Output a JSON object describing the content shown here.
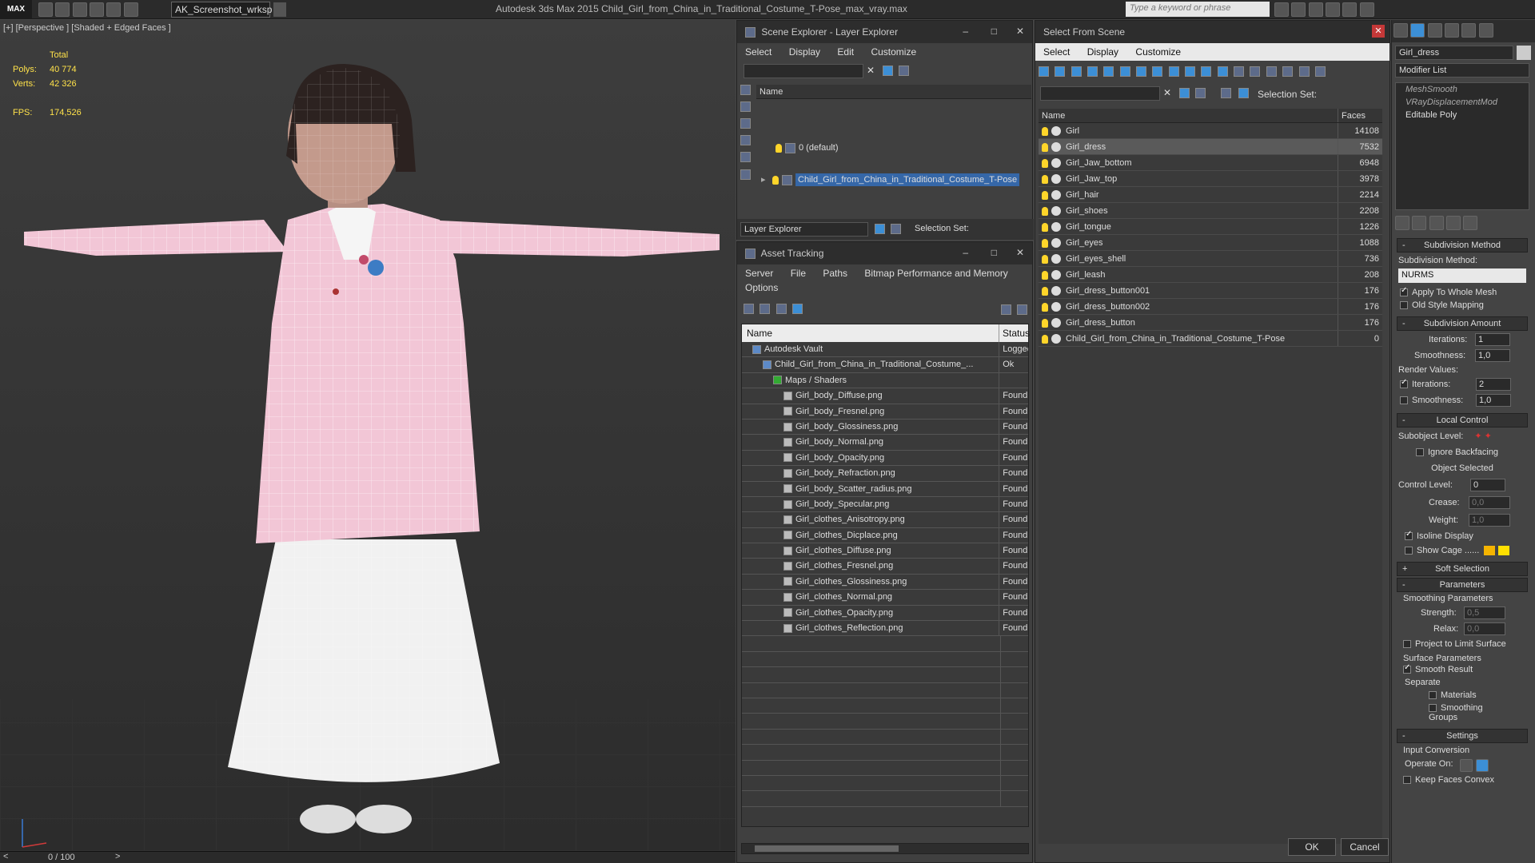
{
  "app": {
    "logo": "MAX",
    "workspace": "AK_Screenshot_wrksp",
    "title": "Autodesk 3ds Max  2015    Child_Girl_from_China_in_Traditional_Costume_T-Pose_max_vray.max",
    "search_placeholder": "Type a keyword or phrase"
  },
  "viewport": {
    "label": "[+] [Perspective ] [Shaded + Edged Faces ]",
    "stats": {
      "total_label": "Total",
      "polys_label": "Polys:",
      "polys": "40 774",
      "verts_label": "Verts:",
      "verts": "42 326",
      "fps_label": "FPS:",
      "fps": "174,526"
    },
    "timeline": "0 / 100",
    "model_colors": {
      "top": "#f2c6d6",
      "skirt": "#f1f1f1"
    }
  },
  "layer_explorer": {
    "title": "Scene Explorer - Layer Explorer",
    "menu": [
      "Select",
      "Display",
      "Edit",
      "Customize"
    ],
    "col_name": "Name",
    "layers": [
      "0 (default)",
      "Child_Girl_from_China_in_Traditional_Costume_T-Pose"
    ],
    "footer_label": "Layer Explorer",
    "selection_set": "Selection Set:"
  },
  "asset_tracking": {
    "title": "Asset Tracking",
    "menu": [
      "Server",
      "File",
      "Paths",
      "Bitmap Performance and Memory"
    ],
    "menu2": "Options",
    "col_name": "Name",
    "col_status": "Status",
    "rows": [
      {
        "name": "Autodesk Vault",
        "status": "Logged",
        "indent": 1
      },
      {
        "name": "Child_Girl_from_China_in_Traditional_Costume_...",
        "status": "Ok",
        "indent": 2
      },
      {
        "name": "Maps / Shaders",
        "status": "",
        "indent": 3
      },
      {
        "name": "Girl_body_Diffuse.png",
        "status": "Found",
        "indent": 4
      },
      {
        "name": "Girl_body_Fresnel.png",
        "status": "Found",
        "indent": 4
      },
      {
        "name": "Girl_body_Glossiness.png",
        "status": "Found",
        "indent": 4
      },
      {
        "name": "Girl_body_Normal.png",
        "status": "Found",
        "indent": 4
      },
      {
        "name": "Girl_body_Opacity.png",
        "status": "Found",
        "indent": 4
      },
      {
        "name": "Girl_body_Refraction.png",
        "status": "Found",
        "indent": 4
      },
      {
        "name": "Girl_body_Scatter_radius.png",
        "status": "Found",
        "indent": 4
      },
      {
        "name": "Girl_body_Specular.png",
        "status": "Found",
        "indent": 4
      },
      {
        "name": "Girl_clothes_Anisotropy.png",
        "status": "Found",
        "indent": 4
      },
      {
        "name": "Girl_clothes_Dicplace.png",
        "status": "Found",
        "indent": 4
      },
      {
        "name": "Girl_clothes_Diffuse.png",
        "status": "Found",
        "indent": 4
      },
      {
        "name": "Girl_clothes_Fresnel.png",
        "status": "Found",
        "indent": 4
      },
      {
        "name": "Girl_clothes_Glossiness.png",
        "status": "Found",
        "indent": 4
      },
      {
        "name": "Girl_clothes_Normal.png",
        "status": "Found",
        "indent": 4
      },
      {
        "name": "Girl_clothes_Opacity.png",
        "status": "Found",
        "indent": 4
      },
      {
        "name": "Girl_clothes_Reflection.png",
        "status": "Found",
        "indent": 4
      }
    ]
  },
  "select_from_scene": {
    "title": "Select From Scene",
    "menu": [
      "Select",
      "Display",
      "Customize"
    ],
    "selection_set": "Selection Set:",
    "col_name": "Name",
    "col_faces": "Faces",
    "rows": [
      {
        "name": "Girl",
        "faces": "14108"
      },
      {
        "name": "Girl_dress",
        "faces": "7532",
        "selected": true
      },
      {
        "name": "Girl_Jaw_bottom",
        "faces": "6948"
      },
      {
        "name": "Girl_Jaw_top",
        "faces": "3978"
      },
      {
        "name": "Girl_hair",
        "faces": "2214"
      },
      {
        "name": "Girl_shoes",
        "faces": "2208"
      },
      {
        "name": "Girl_tongue",
        "faces": "1226"
      },
      {
        "name": "Girl_eyes",
        "faces": "1088"
      },
      {
        "name": "Girl_eyes_shell",
        "faces": "736"
      },
      {
        "name": "Girl_leash",
        "faces": "208"
      },
      {
        "name": "Girl_dress_button001",
        "faces": "176"
      },
      {
        "name": "Girl_dress_button002",
        "faces": "176"
      },
      {
        "name": "Girl_dress_button",
        "faces": "176"
      },
      {
        "name": "Child_Girl_from_China_in_Traditional_Costume_T-Pose",
        "faces": "0"
      }
    ],
    "ok": "OK",
    "cancel": "Cancel"
  },
  "modify": {
    "object_name": "Girl_dress",
    "modifier_list": "Modifier List",
    "stack": [
      "MeshSmooth",
      "VRayDisplacementMod",
      "Editable Poly"
    ],
    "subdivision_method": {
      "header": "Subdivision Method",
      "label": "Subdivision Method:",
      "value": "NURMS",
      "apply": "Apply To Whole Mesh",
      "old": "Old Style Mapping"
    },
    "subdivision_amount": {
      "header": "Subdivision Amount",
      "iter_label": "Iterations:",
      "iter": "1",
      "smooth_label": "Smoothness:",
      "smooth": "1,0",
      "render_label": "Render Values:",
      "r_iter": "2",
      "r_smooth": "1,0"
    },
    "local_control": {
      "header": "Local Control",
      "subobj": "Subobject Level:",
      "ignore": "Ignore Backfacing",
      "selected": "Object Selected",
      "control_label": "Control Level:",
      "control": "0",
      "crease_label": "Crease:",
      "crease": "0,0",
      "weight_label": "Weight:",
      "weight": "1,0",
      "isoline": "Isoline Display",
      "cage": "Show Cage ......"
    },
    "soft_selection": "Soft Selection",
    "parameters": {
      "header": "Parameters",
      "smoothing": "Smoothing Parameters",
      "strength_label": "Strength:",
      "strength": "0,5",
      "relax_label": "Relax:",
      "relax": "0,0",
      "project": "Project to Limit Surface",
      "surface": "Surface Parameters",
      "smooth_result": "Smooth Result",
      "separate": "Separate",
      "materials": "Materials",
      "groups": "Smoothing Groups"
    },
    "settings": {
      "header": "Settings",
      "input": "Input Conversion",
      "operate": "Operate On:",
      "convex": "Keep Faces Convex"
    }
  }
}
